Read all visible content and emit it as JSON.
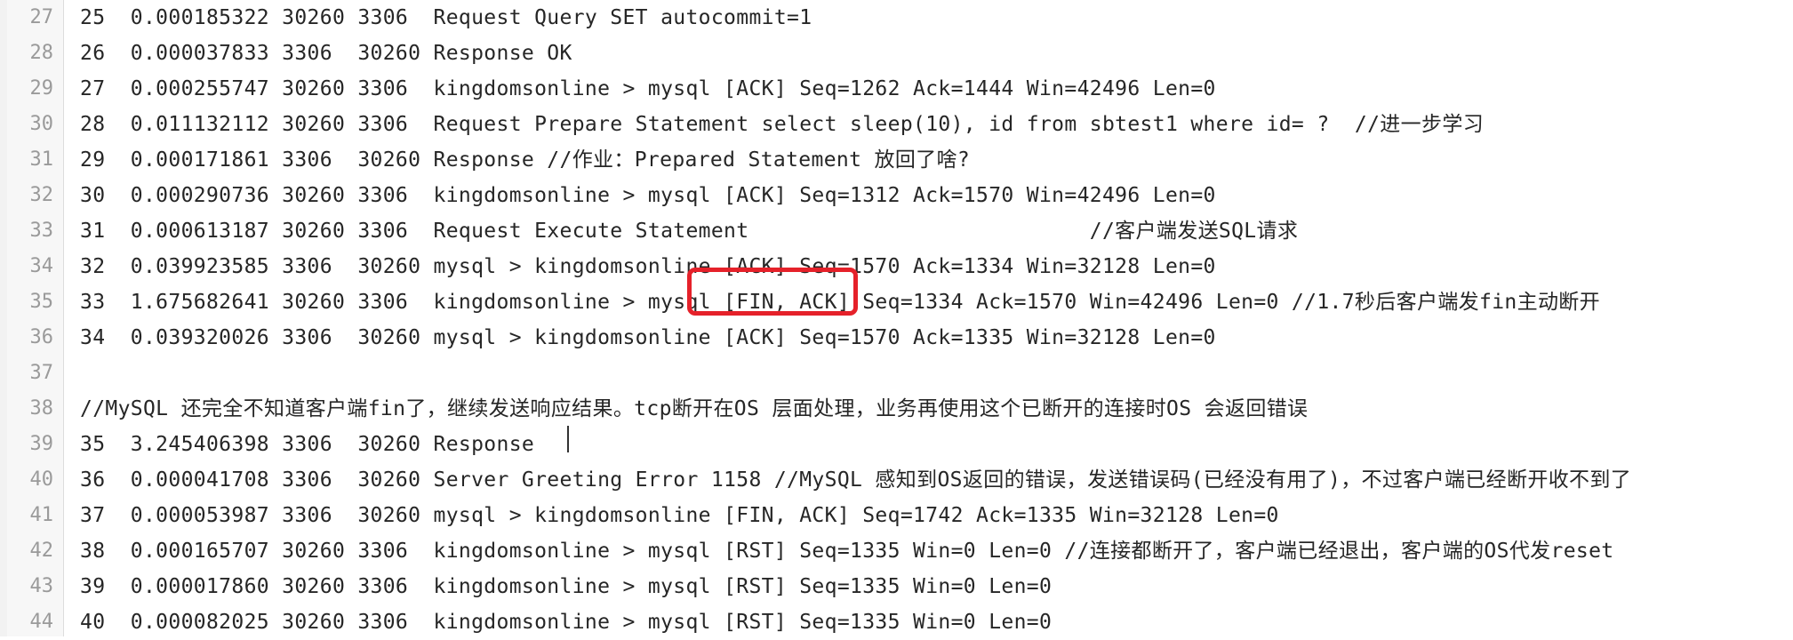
{
  "lines": [
    {
      "num": "27",
      "text": "25  0.000185322 30260 3306  Request Query SET autocommit=1"
    },
    {
      "num": "28",
      "text": "26  0.000037833 3306  30260 Response OK"
    },
    {
      "num": "29",
      "text": "27  0.000255747 30260 3306  kingdomsonline > mysql [ACK] Seq=1262 Ack=1444 Win=42496 Len=0"
    },
    {
      "num": "30",
      "text": "28  0.011132112 30260 3306  Request Prepare Statement select sleep(10), id from sbtest1 where id= ?  //进一步学习"
    },
    {
      "num": "31",
      "text": "29  0.000171861 3306  30260 Response //作业：Prepared Statement 放回了啥?"
    },
    {
      "num": "32",
      "text": "30  0.000290736 30260 3306  kingdomsonline > mysql [ACK] Seq=1312 Ack=1570 Win=42496 Len=0"
    },
    {
      "num": "33",
      "text": "31  0.000613187 30260 3306  Request Execute Statement                           //客户端发送SQL请求"
    },
    {
      "num": "34",
      "text": "32  0.039923585 3306  30260 mysql > kingdomsonline [ACK] Seq=1570 Ack=1334 Win=32128 Len=0"
    },
    {
      "num": "35",
      "text": "33  1.675682641 30260 3306  kingdomsonline > mysql [FIN, ACK] Seq=1334 Ack=1570 Win=42496 Len=0 //1.7秒后客户端发fin主动断开"
    },
    {
      "num": "36",
      "text": "34  0.039320026 3306  30260 mysql > kingdomsonline [ACK] Seq=1570 Ack=1335 Win=32128 Len=0"
    },
    {
      "num": "37",
      "text": ""
    },
    {
      "num": "38",
      "text": "//MySQL 还完全不知道客户端fin了，继续发送响应结果。tcp断开在OS 层面处理，业务再使用这个已断开的连接时OS 会返回错误"
    },
    {
      "num": "39",
      "text": "35  3.245406398 3306  30260 Response"
    },
    {
      "num": "40",
      "text": "36  0.000041708 3306  30260 Server Greeting Error 1158 //MySQL 感知到OS返回的错误，发送错误码(已经没有用了)，不过客户端已经断开收不到了"
    },
    {
      "num": "41",
      "text": "37  0.000053987 3306  30260 mysql > kingdomsonline [FIN, ACK] Seq=1742 Ack=1335 Win=32128 Len=0"
    },
    {
      "num": "42",
      "text": "38  0.000165707 30260 3306  kingdomsonline > mysql [RST] Seq=1335 Win=0 Len=0 //连接都断开了，客户端已经退出，客户端的OS代发reset"
    },
    {
      "num": "43",
      "text": "39  0.000017860 30260 3306  kingdomsonline > mysql [RST] Seq=1335 Win=0 Len=0"
    },
    {
      "num": "44",
      "text": "40  0.000082025 30260 3306  kingdomsonline > mysql [RST] Seq=1335 Win=0 Len=0"
    }
  ],
  "colors": {
    "text": "#262626",
    "line_number": "#9a9a9a",
    "gutter": "#f7f7f7",
    "highlight": "#e5212a"
  }
}
